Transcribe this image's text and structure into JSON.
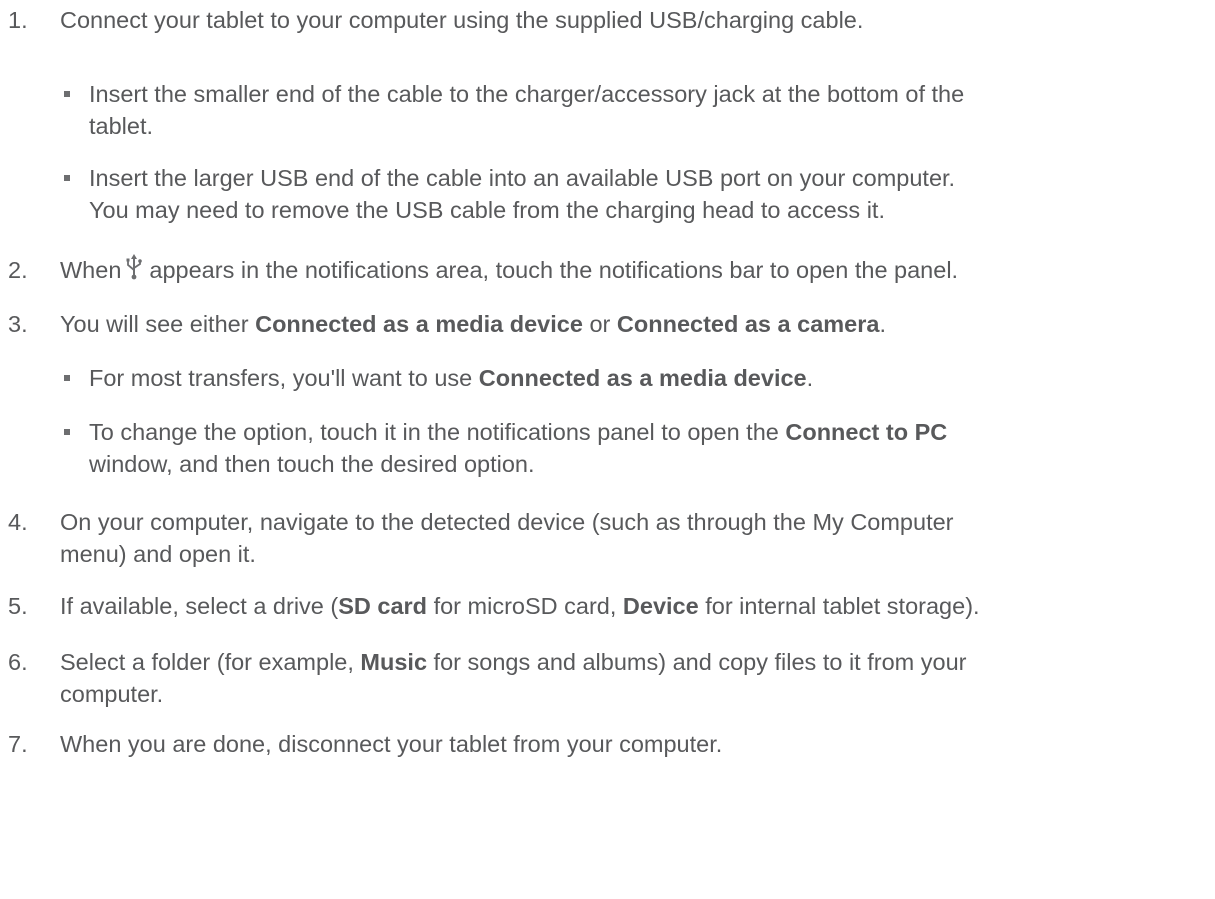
{
  "steps": [
    {
      "number": "1.",
      "text": "Connect your tablet to your computer using the supplied USB/charging cable.",
      "bullets": [
        {
          "line1": "Insert the smaller end of the cable to the charger/accessory jack at the bottom of the",
          "line2": "tablet."
        },
        {
          "line1": "Insert the larger USB end of the cable into an available USB port on your computer.",
          "line2": "You may need to remove the USB cable from the charging head to access it."
        }
      ]
    },
    {
      "number": "2.",
      "text_before": "When",
      "icon": "usb-icon",
      "text_after": "appears in the notifications area, touch the notifications bar to open the panel."
    },
    {
      "number": "3.",
      "text_a": "You will see either ",
      "bold_a": "Connected as a media device",
      "text_b": " or ",
      "bold_b": "Connected as a camera",
      "text_c": ".",
      "bullets": [
        {
          "text_a": "For most transfers, you'll want to use ",
          "bold_a": "Connected as a media device",
          "text_b": "."
        },
        {
          "text_a": "To change the option, touch it in the notifications panel to open the ",
          "bold_a": "Connect to PC",
          "line2": "window, and then touch the desired option."
        }
      ]
    },
    {
      "number": "4.",
      "line1": "On your computer, navigate to the detected device (such as through the My Computer",
      "line2": "menu) and open it."
    },
    {
      "number": "5.",
      "text_a": "If available, select a drive (",
      "bold_a": "SD card",
      "text_b": " for microSD card, ",
      "bold_b": "Device",
      "text_c": " for internal tablet storage)."
    },
    {
      "number": "6.",
      "text_a": "Select a folder (for example, ",
      "bold_a": "Music",
      "text_b": " for songs and albums) and copy files to it from your",
      "line2": "computer."
    },
    {
      "number": "7.",
      "text": "When you are done, disconnect your tablet from your computer."
    }
  ]
}
